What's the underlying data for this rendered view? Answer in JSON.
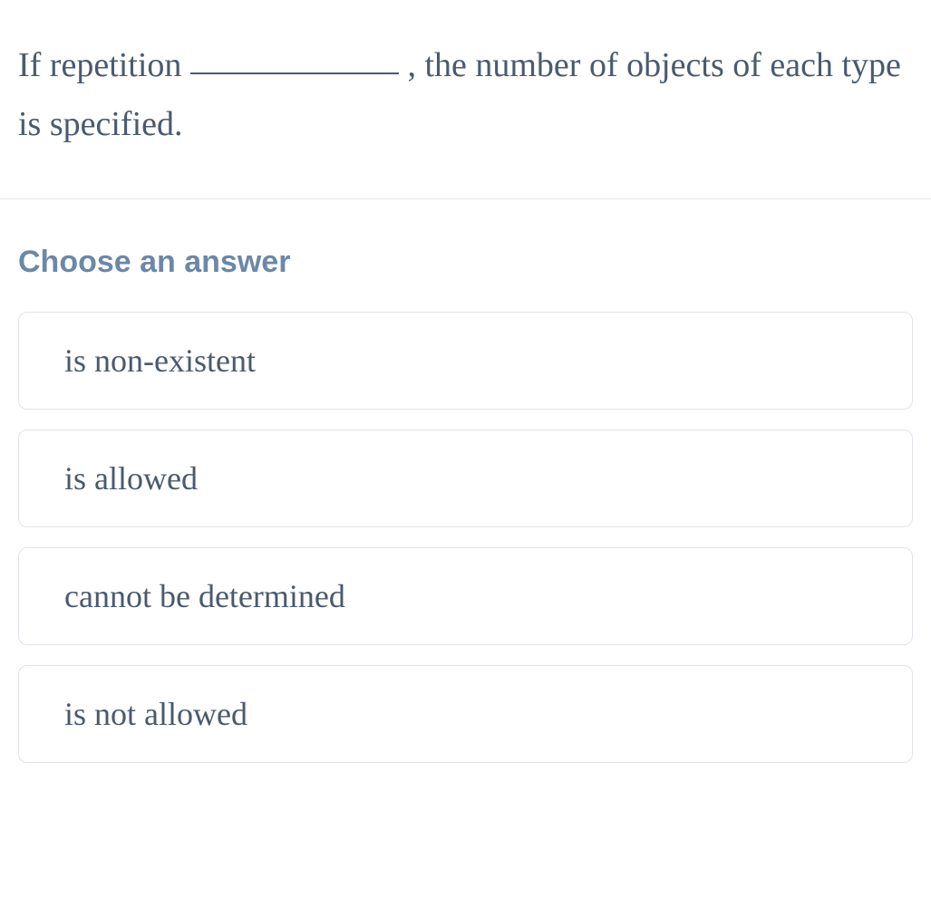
{
  "question": {
    "part1": "If repetition ",
    "part2": " , the number of objects of each type is specified."
  },
  "answerHeading": "Choose an answer",
  "options": [
    {
      "label": "is non-existent"
    },
    {
      "label": "is allowed"
    },
    {
      "label": "cannot be determined"
    },
    {
      "label": "is not allowed"
    }
  ]
}
